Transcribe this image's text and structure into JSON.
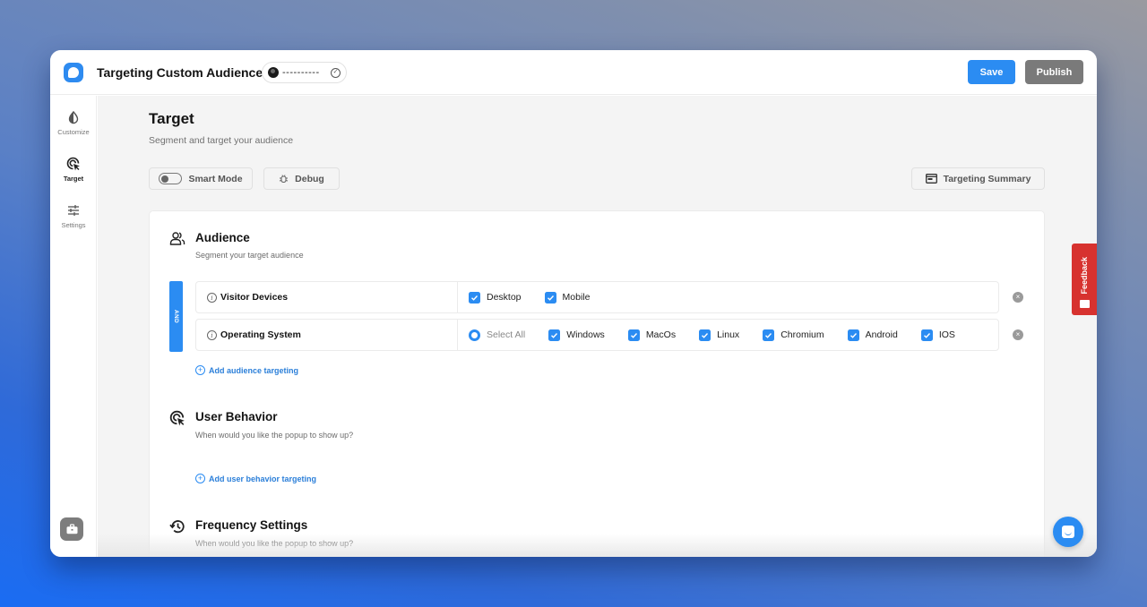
{
  "header": {
    "title": "Targeting Custom Audience",
    "url_display": "----------",
    "save_label": "Save",
    "publish_label": "Publish"
  },
  "sidebar": {
    "items": [
      {
        "label": "Customize",
        "icon": "contrast-icon"
      },
      {
        "label": "Target",
        "icon": "target-cursor-icon",
        "active": true
      },
      {
        "label": "Settings",
        "icon": "sliders-icon"
      }
    ],
    "bottom_icon": "briefcase-icon"
  },
  "main": {
    "title": "Target",
    "subtitle": "Segment and target your audience",
    "smart_mode_label": "Smart Mode",
    "smart_mode_on": false,
    "debug_label": "Debug",
    "summary_label": "Targeting Summary"
  },
  "audience": {
    "title": "Audience",
    "subtitle": "Segment your target audience",
    "operator": "AND",
    "rules": [
      {
        "label": "Visitor Devices",
        "options": [
          {
            "label": "Desktop",
            "checked": true
          },
          {
            "label": "Mobile",
            "checked": true
          }
        ]
      },
      {
        "label": "Operating System",
        "select_all_label": "Select All",
        "options": [
          {
            "label": "Windows",
            "checked": true
          },
          {
            "label": "MacOs",
            "checked": true
          },
          {
            "label": "Linux",
            "checked": true
          },
          {
            "label": "Chromium",
            "checked": true
          },
          {
            "label": "Android",
            "checked": true
          },
          {
            "label": "IOS",
            "checked": true
          }
        ]
      }
    ],
    "add_label": "Add audience targeting"
  },
  "user_behavior": {
    "title": "User Behavior",
    "subtitle": "When would you like the popup to show up?",
    "add_label": "Add user behavior targeting"
  },
  "frequency": {
    "title": "Frequency Settings",
    "subtitle": "When would you like the popup to show up?"
  },
  "feedback_label": "Feedback",
  "colors": {
    "accent": "#2b8cf2",
    "publish": "#7a7a7a",
    "feedback": "#d7322f"
  }
}
